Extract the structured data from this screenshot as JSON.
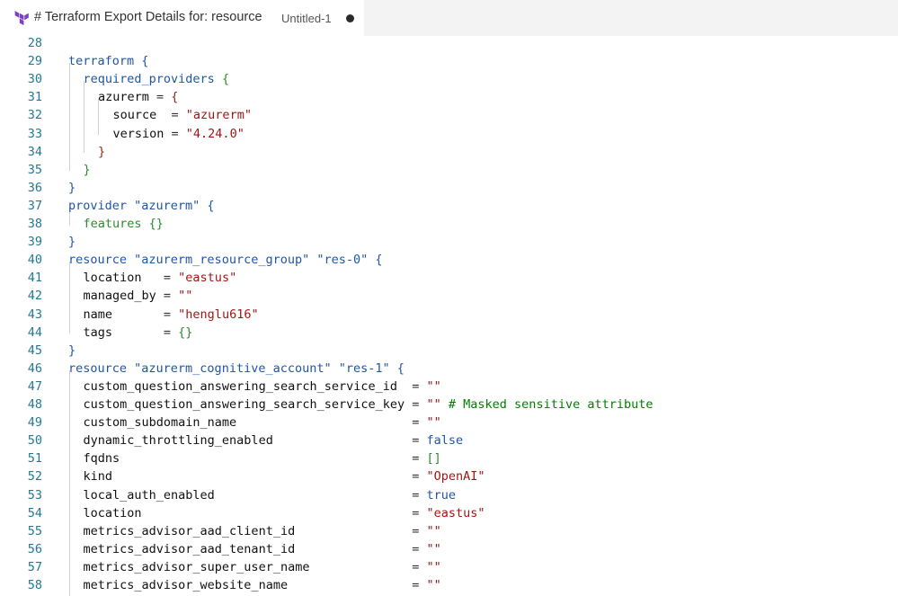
{
  "tab": {
    "title": "# Terraform Export Details for: resource",
    "subtitle": "Untitled-1",
    "icon": "terraform-icon"
  },
  "lines": [
    {
      "n": "28",
      "t": []
    },
    {
      "n": "29",
      "t": [
        [
          "kw",
          "terraform "
        ],
        [
          "bl",
          "{"
        ]
      ]
    },
    {
      "n": "30",
      "t": [
        [
          "bl",
          "required_providers "
        ],
        [
          "gr",
          "{"
        ]
      ]
    },
    {
      "n": "31",
      "t": [
        [
          "attr",
          "azurerm "
        ],
        [
          "pl",
          "= "
        ],
        [
          "br",
          "{"
        ]
      ]
    },
    {
      "n": "32",
      "t": [
        [
          "attr",
          "source  "
        ],
        [
          "pl",
          "= "
        ],
        [
          "str",
          "\"azurerm\""
        ]
      ]
    },
    {
      "n": "33",
      "t": [
        [
          "attr",
          "version "
        ],
        [
          "pl",
          "= "
        ],
        [
          "str",
          "\"4.24.0\""
        ]
      ]
    },
    {
      "n": "34",
      "t": [
        [
          "br",
          "}"
        ]
      ]
    },
    {
      "n": "35",
      "t": [
        [
          "gr",
          "}"
        ]
      ]
    },
    {
      "n": "36",
      "t": [
        [
          "bl",
          "}"
        ]
      ]
    },
    {
      "n": "37",
      "t": [
        [
          "kw",
          "provider "
        ],
        [
          "bl",
          "\"azurerm\" {"
        ]
      ]
    },
    {
      "n": "38",
      "t": [
        [
          "gr",
          "features {}"
        ]
      ]
    },
    {
      "n": "39",
      "t": [
        [
          "bl",
          "}"
        ]
      ]
    },
    {
      "n": "40",
      "t": [
        [
          "kw",
          "resource "
        ],
        [
          "bl",
          "\"azurerm_resource_group\" \"res-0\" {"
        ]
      ]
    },
    {
      "n": "41",
      "t": [
        [
          "attr",
          "location   "
        ],
        [
          "pl",
          "= "
        ],
        [
          "str",
          "\"eastus\""
        ]
      ]
    },
    {
      "n": "42",
      "t": [
        [
          "attr",
          "managed_by "
        ],
        [
          "pl",
          "= "
        ],
        [
          "str",
          "\"\""
        ]
      ]
    },
    {
      "n": "43",
      "t": [
        [
          "attr",
          "name       "
        ],
        [
          "pl",
          "= "
        ],
        [
          "str",
          "\"henglu616\""
        ]
      ]
    },
    {
      "n": "44",
      "t": [
        [
          "attr",
          "tags       "
        ],
        [
          "pl",
          "= "
        ],
        [
          "gr",
          "{}"
        ]
      ]
    },
    {
      "n": "45",
      "t": [
        [
          "bl",
          "}"
        ]
      ]
    },
    {
      "n": "46",
      "t": [
        [
          "kw",
          "resource "
        ],
        [
          "bl",
          "\"azurerm_cognitive_account\" \"res-1\" {"
        ]
      ]
    },
    {
      "n": "47",
      "t": [
        [
          "attr",
          "custom_question_answering_search_service_id  "
        ],
        [
          "pl",
          "= "
        ],
        [
          "str",
          "\"\""
        ]
      ]
    },
    {
      "n": "48",
      "t": [
        [
          "attr",
          "custom_question_answering_search_service_key "
        ],
        [
          "pl",
          "= "
        ],
        [
          "str",
          "\"\" "
        ],
        [
          "cm",
          "# Masked sensitive attribute"
        ]
      ]
    },
    {
      "n": "49",
      "t": [
        [
          "attr",
          "custom_subdomain_name                        "
        ],
        [
          "pl",
          "= "
        ],
        [
          "str",
          "\"\""
        ]
      ]
    },
    {
      "n": "50",
      "t": [
        [
          "attr",
          "dynamic_throttling_enabled                   "
        ],
        [
          "pl",
          "= "
        ],
        [
          "kw",
          "false"
        ]
      ]
    },
    {
      "n": "51",
      "t": [
        [
          "attr",
          "fqdns                                        "
        ],
        [
          "pl",
          "= "
        ],
        [
          "gr",
          "[]"
        ]
      ]
    },
    {
      "n": "52",
      "t": [
        [
          "attr",
          "kind                                         "
        ],
        [
          "pl",
          "= "
        ],
        [
          "str",
          "\"OpenAI\""
        ]
      ]
    },
    {
      "n": "53",
      "t": [
        [
          "attr",
          "local_auth_enabled                           "
        ],
        [
          "pl",
          "= "
        ],
        [
          "kw",
          "true"
        ]
      ]
    },
    {
      "n": "54",
      "t": [
        [
          "attr",
          "location                                     "
        ],
        [
          "pl",
          "= "
        ],
        [
          "str",
          "\"eastus\""
        ]
      ]
    },
    {
      "n": "55",
      "t": [
        [
          "attr",
          "metrics_advisor_aad_client_id                "
        ],
        [
          "pl",
          "= "
        ],
        [
          "str",
          "\"\""
        ]
      ]
    },
    {
      "n": "56",
      "t": [
        [
          "attr",
          "metrics_advisor_aad_tenant_id                "
        ],
        [
          "pl",
          "= "
        ],
        [
          "str",
          "\"\""
        ]
      ]
    },
    {
      "n": "57",
      "t": [
        [
          "attr",
          "metrics_advisor_super_user_name              "
        ],
        [
          "pl",
          "= "
        ],
        [
          "str",
          "\"\""
        ]
      ]
    },
    {
      "n": "58",
      "t": [
        [
          "attr",
          "metrics_advisor_website_name                 "
        ],
        [
          "pl",
          "= "
        ],
        [
          "str",
          "\"\""
        ]
      ]
    }
  ],
  "colors": {
    "line_number": "#237893",
    "keyword": "#1f56a6",
    "string": "#a31515",
    "bracket_green": "#2f8a2f",
    "bracket_brown": "#8b2c1c",
    "comment": "#008000"
  }
}
